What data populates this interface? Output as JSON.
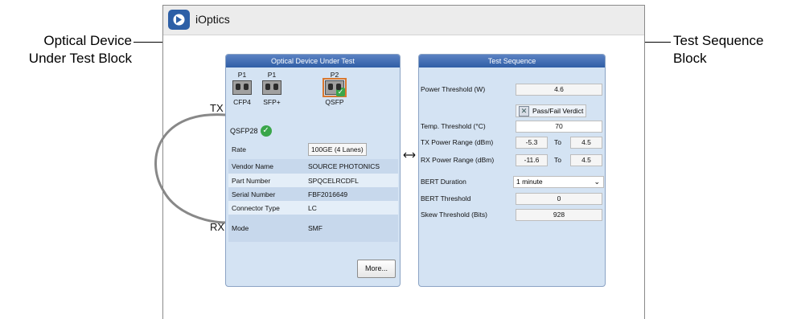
{
  "callouts": {
    "left_line1": "Optical Device",
    "left_line2": "Under Test Block",
    "right_line1": "Test Sequence",
    "right_line2": "Block"
  },
  "app": {
    "title": "iOptics"
  },
  "loop": {
    "tx": "TX",
    "rx": "RX"
  },
  "dut": {
    "header": "Optical Device Under Test",
    "ports": [
      {
        "num": "P1",
        "name": "CFP4"
      },
      {
        "num": "P1",
        "name": "SFP+"
      },
      {
        "num": "P2",
        "name": "QSFP"
      }
    ],
    "module": "QSFP28",
    "rows": [
      {
        "label": "Rate",
        "value": "100GE (4 Lanes)"
      },
      {
        "label": "Vendor Name",
        "value": "SOURCE PHOTONICS"
      },
      {
        "label": "Part Number",
        "value": "SPQCELRCDFL"
      },
      {
        "label": "Serial Number",
        "value": "FBF2016649"
      },
      {
        "label": "Connector Type",
        "value": "LC"
      },
      {
        "label": "Mode",
        "value": "SMF"
      }
    ],
    "more_label": "More..."
  },
  "seq": {
    "header": "Test Sequence",
    "power_threshold_label": "Power Threshold (W)",
    "power_threshold": "4.6",
    "verdict_label": "Pass/Fail Verdict",
    "temp_label": "Temp. Threshold (°C)",
    "temp": "70",
    "tx_label": "TX Power Range (dBm)",
    "tx_min": "-5.3",
    "tx_max": "4.5",
    "rx_label": "RX Power Range (dBm)",
    "rx_min": "-11.6",
    "rx_max": "4.5",
    "to": "To",
    "bert_duration_label": "BERT Duration",
    "bert_duration": "1 minute",
    "bert_threshold_label": "BERT Threshold",
    "bert_threshold": "0",
    "skew_label": "Skew Threshold (Bits)",
    "skew": "928"
  }
}
